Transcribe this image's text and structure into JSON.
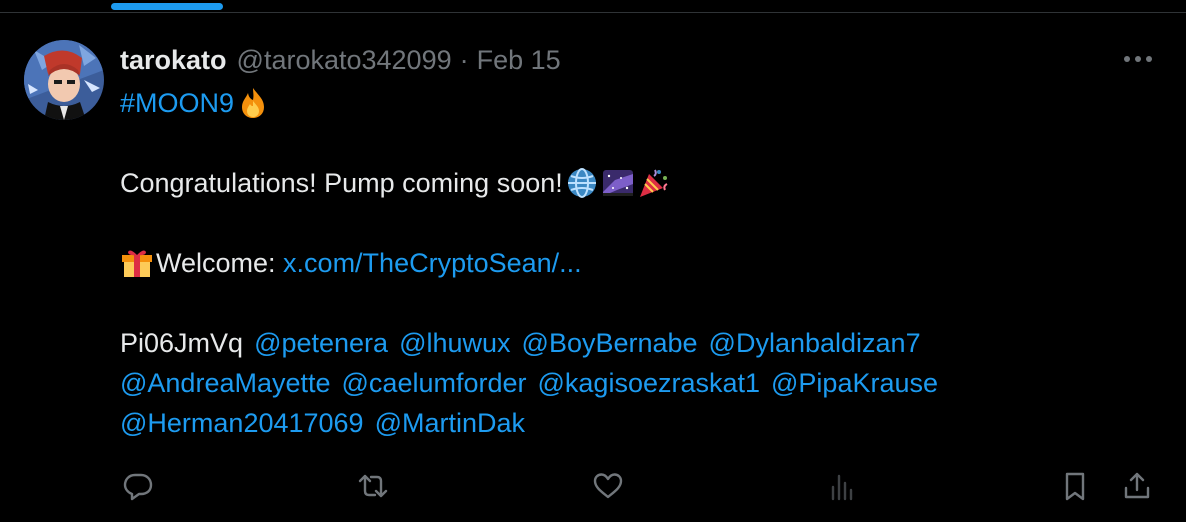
{
  "tweet": {
    "display_name": "tarokato",
    "handle": "@tarokato342099",
    "separator": "·",
    "date": "Feb 15",
    "hashtag": "#MOON9",
    "hashtag_emoji": "fire-emoji",
    "line2_text": "Congratulations! Pump coming soon!",
    "line2_emojis": [
      "globe-emoji",
      "milky-way-emoji",
      "party-popper-emoji"
    ],
    "gift_emoji": "gift-emoji",
    "welcome_label": "Welcome: ",
    "welcome_link": "x.com/TheCryptoSean/...",
    "code_text": "Pi06JmVq",
    "mentions_line1": [
      "@petenera",
      "@lhuwux",
      "@BoyBernabe",
      "@Dylanbaldizan7"
    ],
    "mentions_line2": [
      "@AndreaMayette",
      "@caelumforder",
      "@kagisoezraskat1",
      "@PipaKrause"
    ],
    "mentions_line3": [
      "@Herman20417069",
      "@MartinDak"
    ]
  },
  "actions": {
    "reply_icon": "reply-icon",
    "retweet_icon": "retweet-icon",
    "like_icon": "heart-icon",
    "views_icon": "analytics-icon",
    "bookmark_icon": "bookmark-icon",
    "share_icon": "share-icon"
  },
  "colors": {
    "background": "#000000",
    "text": "#e7e9ea",
    "muted": "#71767b",
    "accent": "#1d9bf0",
    "divider": "#2f3336"
  }
}
